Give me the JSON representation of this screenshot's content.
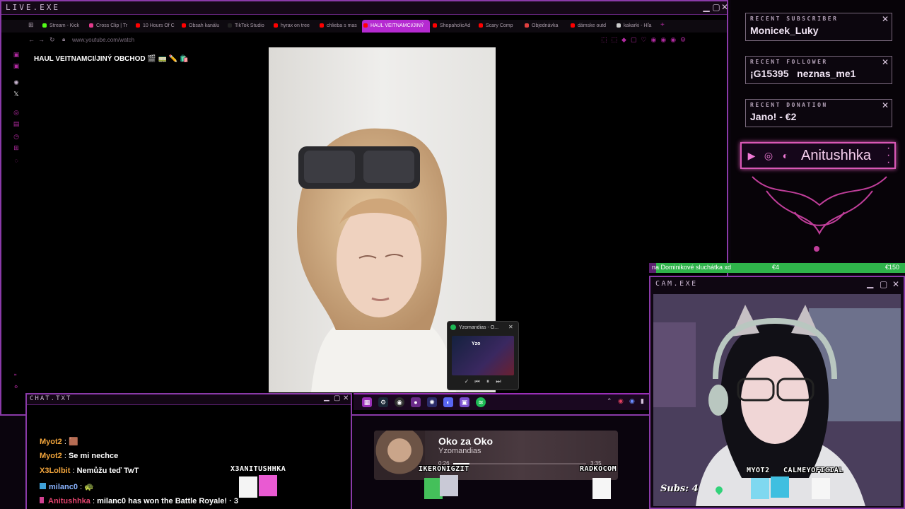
{
  "live_window": {
    "title": "LIVE.EXE",
    "tabs": [
      {
        "label": "Stream - Kick",
        "color": "#53fc18"
      },
      {
        "label": "Cross Clip | Tr",
        "color": "#e33a8c"
      },
      {
        "label": "10 Hours Of C",
        "color": "#ff0000"
      },
      {
        "label": "Obsah kanálu",
        "color": "#ff0000"
      },
      {
        "label": "TikTok Studio",
        "color": "#222222"
      },
      {
        "label": "hyrax on tree",
        "color": "#ff0000"
      },
      {
        "label": "chlieba s mas",
        "color": "#ff0000"
      },
      {
        "label": "HAUL VEITNAMCI/JINÝ",
        "color": "#ff0000",
        "active": true
      },
      {
        "label": "ShopaholicAd",
        "color": "#ff0000"
      },
      {
        "label": "Scary Comp",
        "color": "#ff0000"
      },
      {
        "label": "Objednávka",
        "color": "#e04040"
      },
      {
        "label": "dámske outd",
        "color": "#ff0000"
      },
      {
        "label": "kakarki - Hľa",
        "color": "#cccccc"
      }
    ],
    "address": "www.youtube.com/watch",
    "video_title": "HAUL VEITNAMCI/JINÝ OBCHOD 🎬 🚃 ✏️ 🛍️"
  },
  "spotify_popup": {
    "title": "Yzomandias - O...",
    "thumb_label": "Yzo"
  },
  "chat": {
    "title": "CHAT.TXT",
    "messages": [
      {
        "user": "Myot2",
        "color": "#f2a53c",
        "sep": " : ",
        "text": "🟫"
      },
      {
        "user": "Myot2",
        "color": "#f2a53c",
        "sep": " : ",
        "text": "Se mi nechce"
      },
      {
        "user": "X3Lolbit",
        "color": "#f2a53c",
        "sep": " : ",
        "text": "Nemůžu teď TwT"
      },
      {
        "user": "milanc0",
        "color": "#8ab4ff",
        "sep": " : ",
        "text": "🐢"
      },
      {
        "user": "Anitushhka",
        "color": "#e0436c",
        "sep": " : ",
        "text": "milanc0 has won the Battle Royale! · 3"
      }
    ]
  },
  "now_playing": {
    "title": "Oko za Oko",
    "artist": "Yzomandias",
    "elapsed": "0:26",
    "total": "3:35",
    "progress": 0.12
  },
  "pixel_viewers": [
    "X3ANITUSHHKA",
    "IKERONIGZIT",
    "RADKOCOM",
    "MYOT2",
    "CALMEYOFICIAL"
  ],
  "alerts": {
    "subscriber": {
      "label": "RECENT SUBSCRIBER",
      "value": "Monicek_Luky"
    },
    "follower": {
      "label": "RECENT FOLLOWER",
      "value": "¡G15395   neznas_me1"
    },
    "donation": {
      "label": "RECENT DONATION",
      "value": "Jano! - €2"
    }
  },
  "social": {
    "handle": "Anitushhka"
  },
  "goal": {
    "text": "na Dominikové sluchátka xd",
    "current": "€4",
    "target": "€150",
    "fraction": 0.027
  },
  "cam": {
    "title": "CAM.EXE",
    "subs_text": "Subs: 4"
  },
  "colors": {
    "frame": "#8a3aa8",
    "accent": "#d958b6",
    "goal": "#2fb44b"
  }
}
